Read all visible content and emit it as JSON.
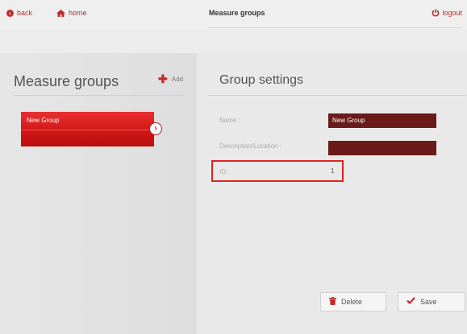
{
  "topbar": {
    "back_label": "back",
    "home_label": "home",
    "title": "Measure groups",
    "logout_label": "logout"
  },
  "left": {
    "title": "Measure groups",
    "add_label": "Add",
    "groups": [
      {
        "label": "New Group"
      }
    ]
  },
  "right": {
    "title": "Group settings",
    "fields": {
      "name_label": "Name :",
      "name_value": "New Group",
      "description_label": "Description/Location :",
      "description_value": "",
      "id_label": "ID:",
      "id_value": "1"
    },
    "delete_label": "Delete",
    "save_label": "Save"
  },
  "icons": {
    "back": "back-circle-icon",
    "home": "home-icon",
    "logout": "power-icon",
    "add": "plus-icon",
    "arrow": "chevron-right-icon",
    "delete": "trash-icon",
    "save": "checkmark-icon"
  },
  "colors": {
    "accent": "#c42a2a",
    "selected_item": "#d21717",
    "input_bg": "#6b1a1a",
    "highlight_border": "#e02020"
  }
}
